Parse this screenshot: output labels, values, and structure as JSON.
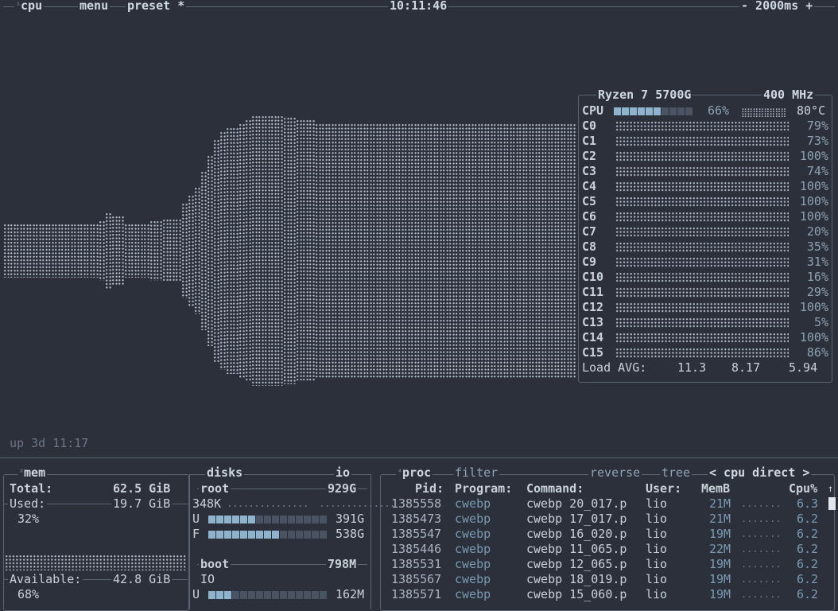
{
  "topbar": {
    "cpu_num": "¹",
    "cpu_label": "cpu",
    "menu_label": "menu",
    "preset_label": "preset *",
    "clock": "10:11:46",
    "interval": "- 2000ms +"
  },
  "uptime": "up 3d 11:17",
  "cpu_box": {
    "model": "Ryzen 7 5700G",
    "freq": "400 MHz",
    "total_label": "CPU",
    "total_pct": "66%",
    "total_fill": 0.6,
    "temp": "80°C",
    "cores": [
      {
        "name": "C0",
        "pct": "79%"
      },
      {
        "name": "C1",
        "pct": "73%"
      },
      {
        "name": "C2",
        "pct": "100%"
      },
      {
        "name": "C3",
        "pct": "74%"
      },
      {
        "name": "C4",
        "pct": "100%"
      },
      {
        "name": "C5",
        "pct": "100%"
      },
      {
        "name": "C6",
        "pct": "100%"
      },
      {
        "name": "C7",
        "pct": "20%"
      },
      {
        "name": "C8",
        "pct": "35%"
      },
      {
        "name": "C9",
        "pct": "31%"
      },
      {
        "name": "C10",
        "pct": "16%"
      },
      {
        "name": "C11",
        "pct": "29%"
      },
      {
        "name": "C12",
        "pct": "100%"
      },
      {
        "name": "C13",
        "pct": "5%"
      },
      {
        "name": "C14",
        "pct": "100%"
      },
      {
        "name": "C15",
        "pct": "86%"
      }
    ],
    "load_label": "Load AVG:",
    "load_1": "11.3",
    "load_5": "8.17",
    "load_15": "5.94"
  },
  "mem": {
    "num": "²",
    "title": "mem",
    "total_label": "Total:",
    "total_val": "62.5 GiB",
    "used_label": "Used:",
    "used_val": "19.7 GiB",
    "used_pct": "32%",
    "avail_label": "Available:",
    "avail_val": "42.8 GiB",
    "avail_pct": "68%"
  },
  "disks": {
    "title": "disks",
    "io_label": "io",
    "root_name": "root",
    "root_size": "929G",
    "root_io": "348K",
    "root_used_label": "U",
    "root_used": "391G",
    "root_used_fill": 0.42,
    "root_free_label": "F",
    "root_free": "538G",
    "root_free_fill": 0.58,
    "boot_name": "boot",
    "boot_size": "798M",
    "boot_io": "IO",
    "boot_used_label": "U",
    "boot_used": "162M",
    "boot_used_fill": 0.2
  },
  "proc": {
    "num": "⁴",
    "title": "proc",
    "filter_label": "filter",
    "reverse_label": "reverse",
    "tree_label": "tree",
    "sort_label": "< cpu direct >",
    "headers": {
      "pid": "Pid:",
      "program": "Program:",
      "command": "Command:",
      "user": "User:",
      "mem": "MemB",
      "cpu": "Cpu%"
    },
    "rows": [
      {
        "pid": "1385558",
        "program": "cwebp",
        "command": "cwebp 20_017.p",
        "user": "lio",
        "mem": "21M",
        "cpu": "6.3"
      },
      {
        "pid": "1385473",
        "program": "cwebp",
        "command": "cwebp 17_017.p",
        "user": "lio",
        "mem": "21M",
        "cpu": "6.2"
      },
      {
        "pid": "1385547",
        "program": "cwebp",
        "command": "cwebp 16_020.p",
        "user": "lio",
        "mem": "19M",
        "cpu": "6.2"
      },
      {
        "pid": "1385446",
        "program": "cwebp",
        "command": "cwebp 11_065.p",
        "user": "lio",
        "mem": "22M",
        "cpu": "6.2"
      },
      {
        "pid": "1385531",
        "program": "cwebp",
        "command": "cwebp 12_065.p",
        "user": "lio",
        "mem": "19M",
        "cpu": "6.2"
      },
      {
        "pid": "1385567",
        "program": "cwebp",
        "command": "cwebp 18_019.p",
        "user": "lio",
        "mem": "19M",
        "cpu": "6.2"
      },
      {
        "pid": "1385571",
        "program": "cwebp",
        "command": "cwebp 15_060.p",
        "user": "lio",
        "mem": "19M",
        "cpu": "6.2"
      }
    ]
  }
}
